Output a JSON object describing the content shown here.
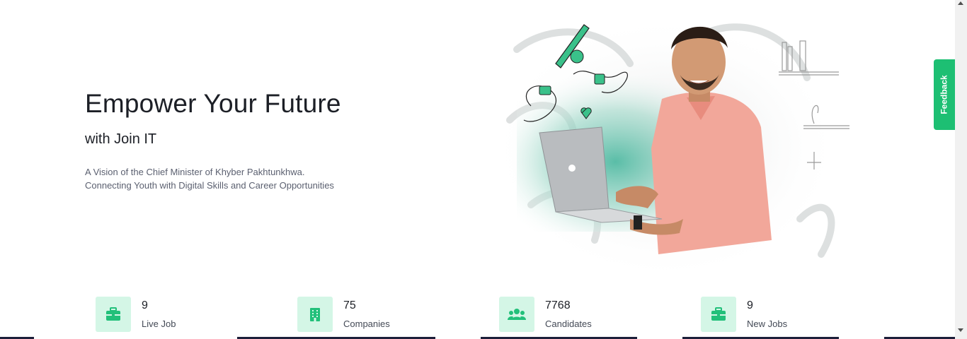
{
  "hero": {
    "title": "Empower Your Future",
    "subtitle": "with Join IT",
    "description_line1": "A Vision of the Chief Minister of Khyber Pakhtunkhwa.",
    "description_line2": "Connecting Youth with Digital Skills and Career Opportunities"
  },
  "stats": [
    {
      "value": "9",
      "label": "Live Job",
      "icon": "briefcase-icon"
    },
    {
      "value": "75",
      "label": "Companies",
      "icon": "building-icon"
    },
    {
      "value": "7768",
      "label": "Candidates",
      "icon": "users-icon"
    },
    {
      "value": "9",
      "label": "New Jobs",
      "icon": "briefcase-icon"
    }
  ],
  "feedback": {
    "label": "Feedback"
  },
  "colors": {
    "accent": "#1dbf73",
    "icon_bg": "#d4f6e6"
  }
}
